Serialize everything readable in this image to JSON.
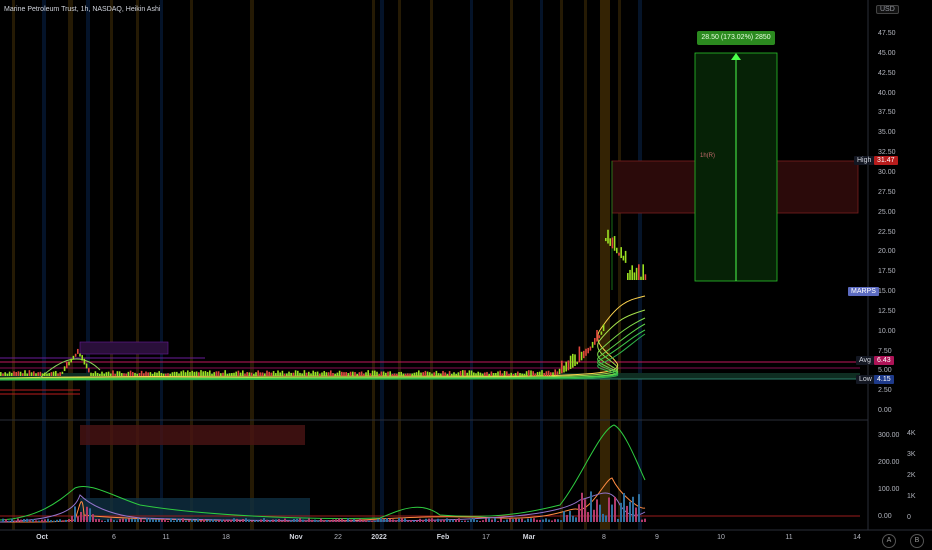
{
  "header": {
    "title": "Marine Petroleum Trust, 1h, NASDAQ, Heikin Ashi"
  },
  "currency": "USD",
  "price_axis": [
    "47.50",
    "45.00",
    "42.50",
    "40.00",
    "37.50",
    "35.00",
    "32.50",
    "30.00",
    "27.50",
    "25.00",
    "22.50",
    "20.00",
    "17.50",
    "15.00",
    "12.50",
    "10.00",
    "7.50",
    "5.00",
    "2.50",
    "0.00"
  ],
  "price_tags": {
    "high_label": "High",
    "high_value": "31.47",
    "symbol_value": "MARPS",
    "avg_label": "Avg",
    "avg_value": "6.43",
    "low_label": "Low",
    "low_value": "4.15"
  },
  "target_label": "28.50 (173.02%) 2850",
  "range_label": "1h(R)",
  "volume_axis_left": [
    "300.00",
    "200.00",
    "100.00",
    "0.00"
  ],
  "volume_axis_right": [
    "4K",
    "3K",
    "2K",
    "1K",
    "0"
  ],
  "time_axis": [
    "Oct",
    "6",
    "11",
    "18",
    "Nov",
    "22",
    "2022",
    "Feb",
    "17",
    "Mar",
    "8",
    "9",
    "10",
    "11",
    "14"
  ],
  "nav": {
    "a": "A",
    "b": "B"
  },
  "colors": {
    "bg": "#000000",
    "up": "#9be022",
    "down": "#e0463c",
    "accent": "#2962ff",
    "target": "#2b8a1f"
  }
}
